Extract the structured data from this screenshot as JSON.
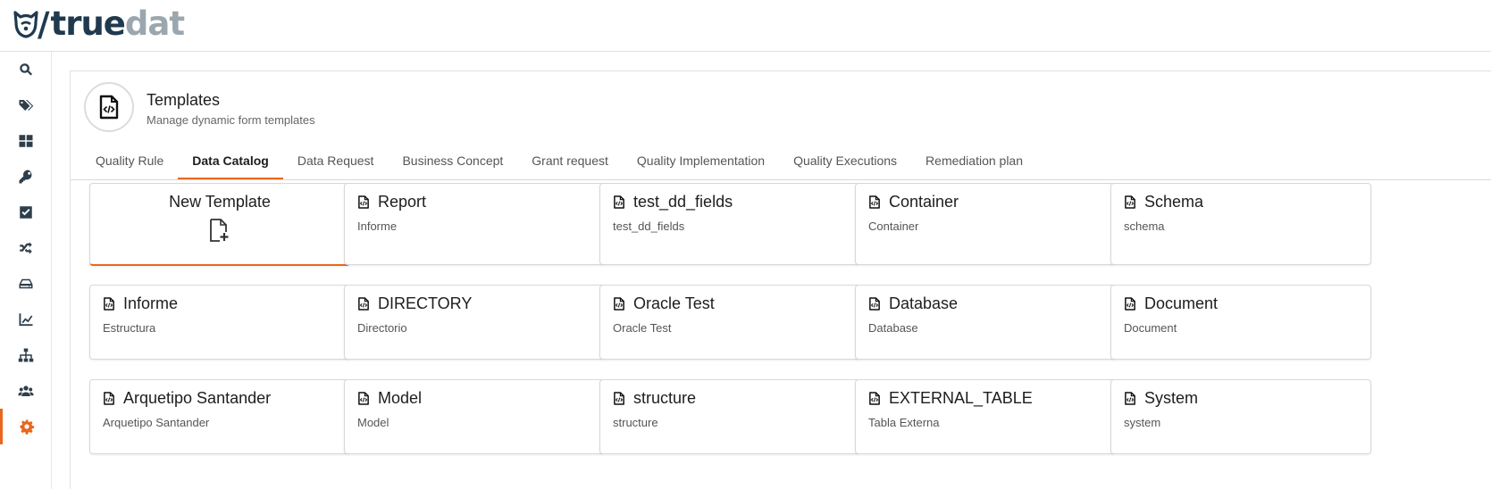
{
  "app": {
    "logo_true": "true",
    "logo_dat": "dat"
  },
  "sidebar": {
    "items": [
      {
        "icon": "search-icon"
      },
      {
        "icon": "tags-icon"
      },
      {
        "icon": "dashboard-icon"
      },
      {
        "icon": "key-icon"
      },
      {
        "icon": "check-square-icon"
      },
      {
        "icon": "shuffle-icon"
      },
      {
        "icon": "hard-drive-icon"
      },
      {
        "icon": "line-chart-icon"
      },
      {
        "icon": "sitemap-icon"
      },
      {
        "icon": "users-icon"
      },
      {
        "icon": "gear-icon",
        "active": true
      }
    ]
  },
  "page": {
    "title": "Templates",
    "subtitle": "Manage dynamic form templates"
  },
  "tabs": [
    {
      "label": "Quality Rule"
    },
    {
      "label": "Data Catalog",
      "active": true
    },
    {
      "label": "Data Request"
    },
    {
      "label": "Business Concept"
    },
    {
      "label": "Grant request"
    },
    {
      "label": "Quality Implementation"
    },
    {
      "label": "Quality Executions"
    },
    {
      "label": "Remediation plan"
    }
  ],
  "new_template": {
    "label": "New Template"
  },
  "templates": [
    {
      "name": "Report",
      "label": "Informe"
    },
    {
      "name": "test_dd_fields",
      "label": "test_dd_fields"
    },
    {
      "name": "Container",
      "label": "Container"
    },
    {
      "name": "Schema",
      "label": "schema"
    },
    {
      "name": "Informe",
      "label": "Estructura"
    },
    {
      "name": "DIRECTORY",
      "label": "Directorio"
    },
    {
      "name": "Oracle Test",
      "label": "Oracle Test"
    },
    {
      "name": "Database",
      "label": "Database"
    },
    {
      "name": "Document",
      "label": "Document"
    },
    {
      "name": "Arquetipo Santander",
      "label": "Arquetipo Santander"
    },
    {
      "name": "Model",
      "label": "Model"
    },
    {
      "name": "structure",
      "label": "structure"
    },
    {
      "name": "EXTERNAL_TABLE",
      "label": "Tabla Externa"
    },
    {
      "name": "System",
      "label": "system"
    }
  ],
  "colors": {
    "accent": "#e8671c",
    "brand_dark": "#1f3a4f",
    "brand_light": "#9aa7ae"
  }
}
